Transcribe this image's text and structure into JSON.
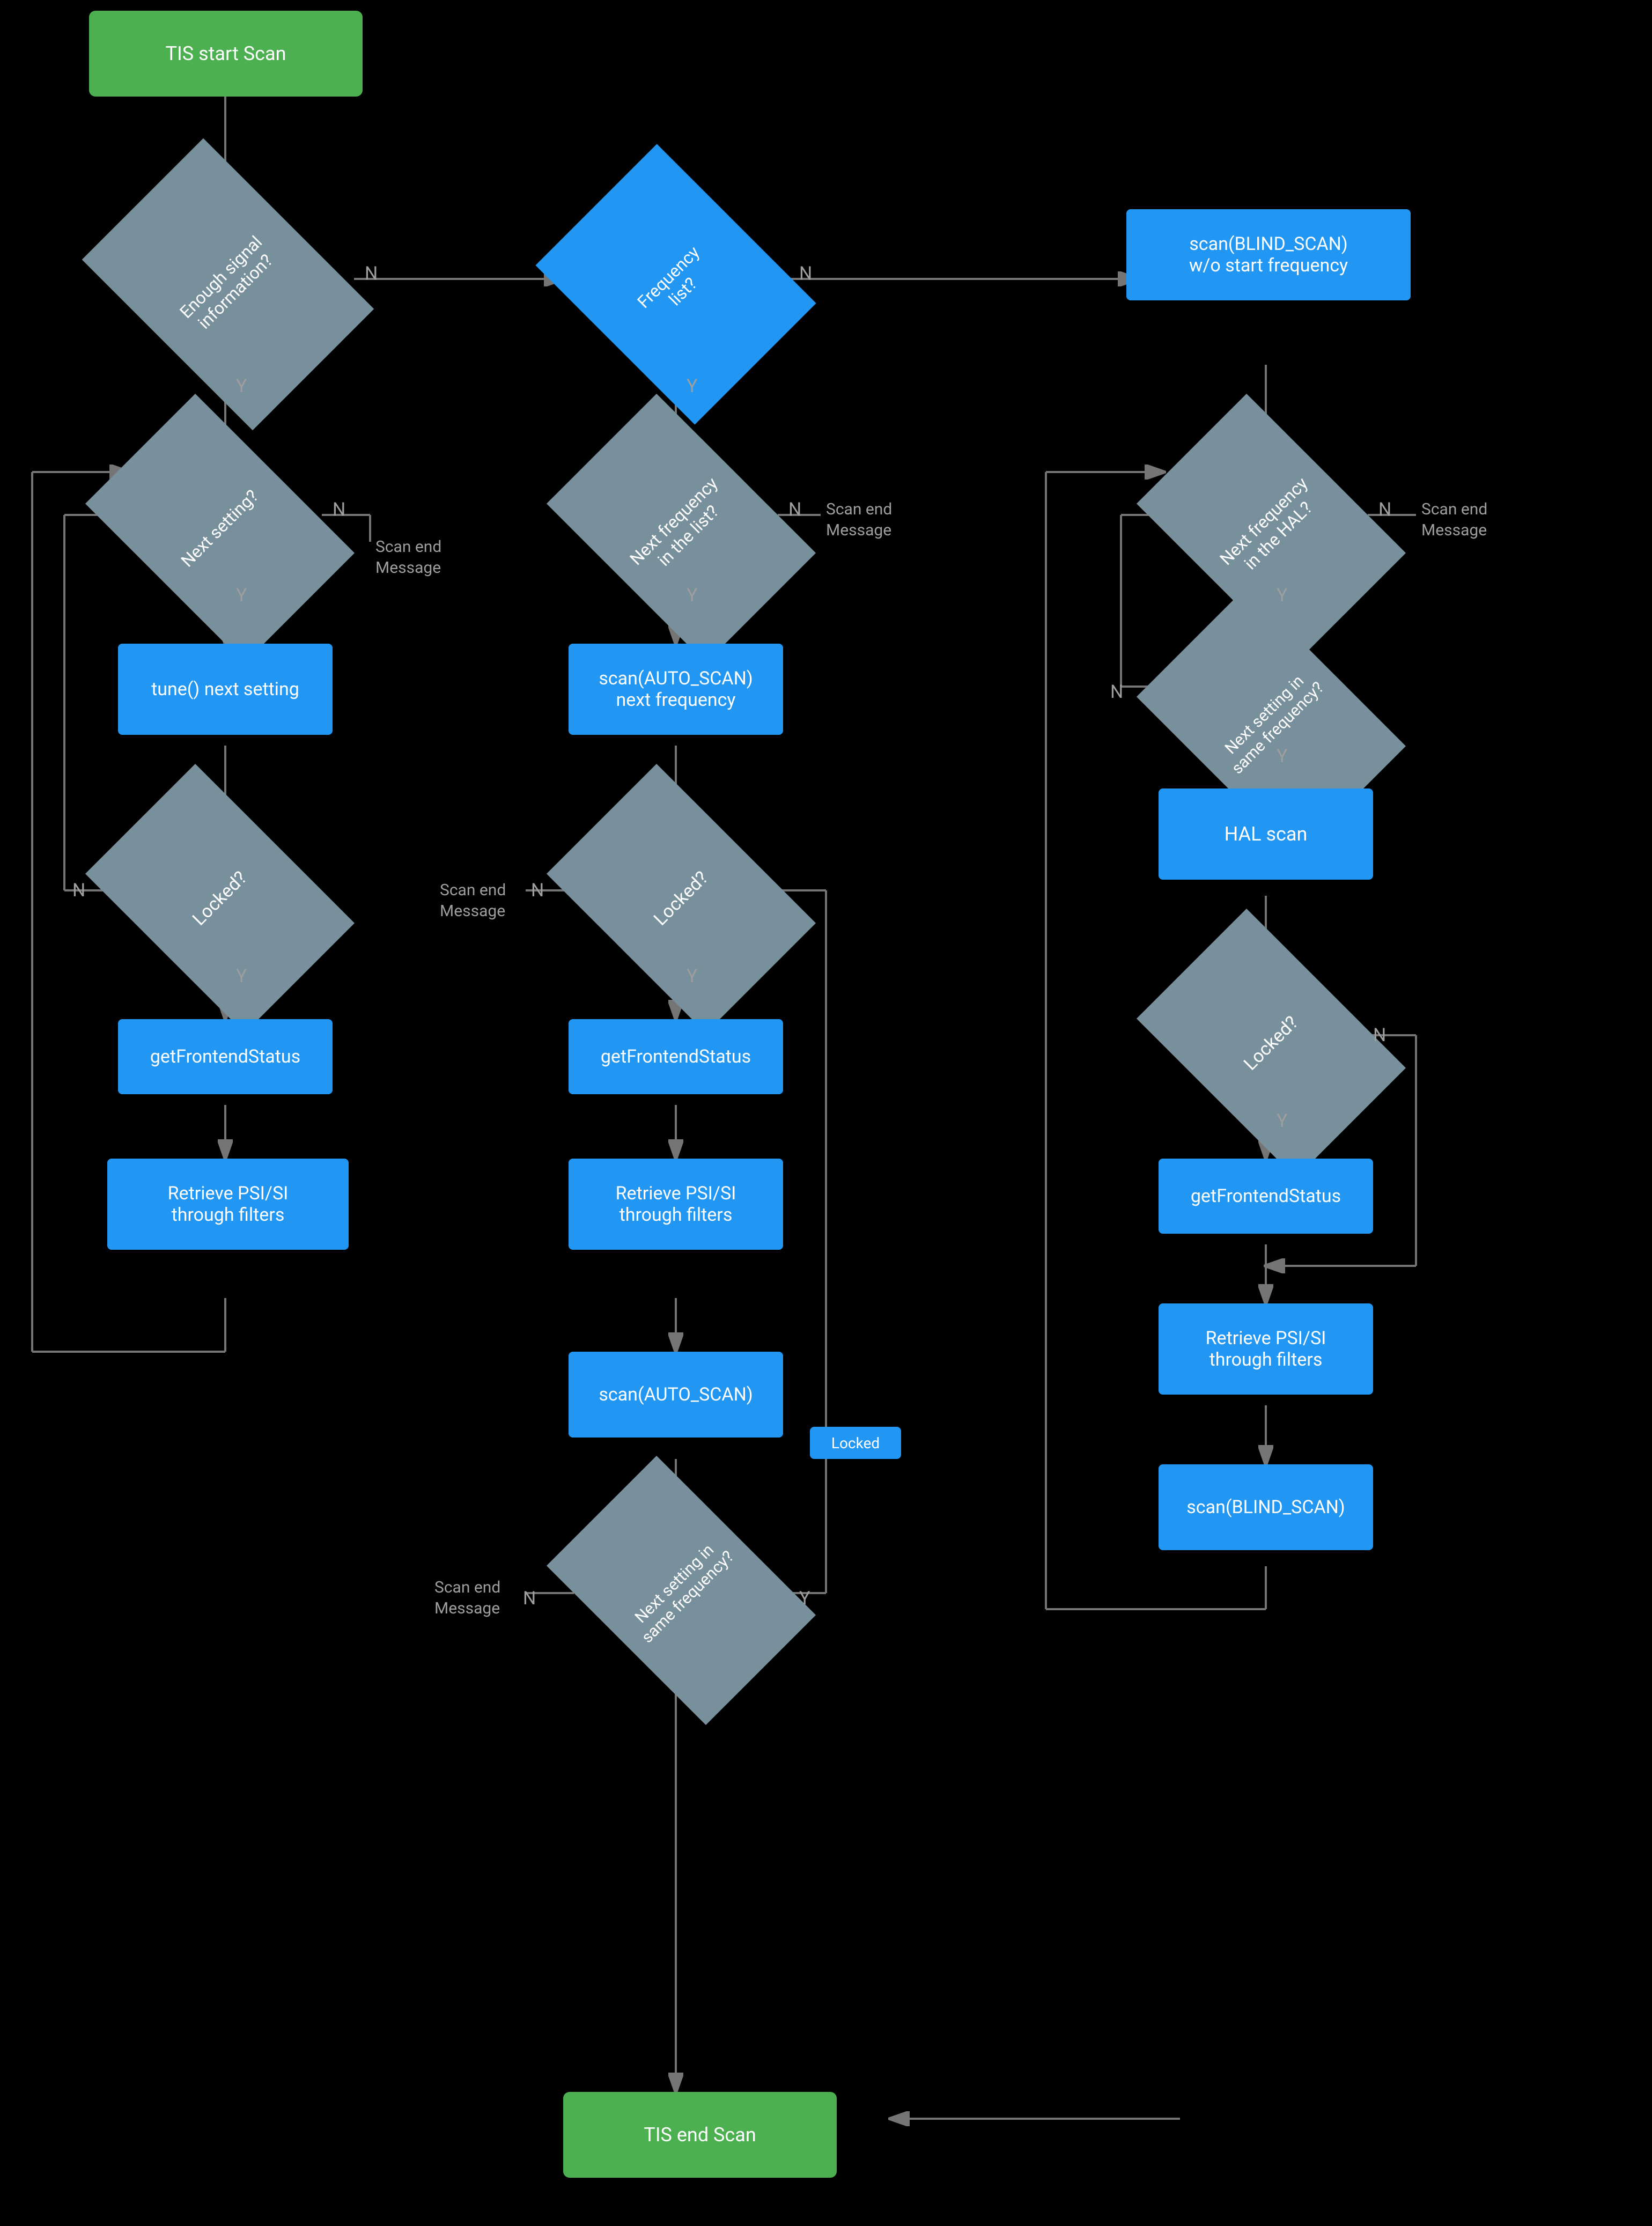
{
  "nodes": {
    "start": {
      "label": "TIS start Scan"
    },
    "enough_signal": {
      "label": "Enough signal\ninformation?"
    },
    "frequency_list": {
      "label": "Frequency\nlist?"
    },
    "blind_scan_no_start": {
      "label": "scan(BLIND_SCAN)\nw/o start frequency"
    },
    "next_setting": {
      "label": "Next setting?"
    },
    "next_freq_list": {
      "label": "Next frequency\nin the list?"
    },
    "next_freq_hal": {
      "label": "Next frequency\nin the HAL?"
    },
    "tune_next": {
      "label": "tune() next setting"
    },
    "scan_auto_next": {
      "label": "scan(AUTO_SCAN)\nnext frequency"
    },
    "next_setting_same_freq_right": {
      "label": "Next setting in\nsame frequency?"
    },
    "locked1": {
      "label": "Locked?"
    },
    "locked2": {
      "label": "Locked?"
    },
    "hal_scan": {
      "label": "HAL scan"
    },
    "get_frontend1": {
      "label": "getFrontendStatus"
    },
    "get_frontend2": {
      "label": "getFrontendStatus"
    },
    "locked3": {
      "label": "Locked?"
    },
    "get_frontend3": {
      "label": "getFrontendStatus"
    },
    "retrieve_psi1": {
      "label": "Retrieve PSI/SI\nthrough filters"
    },
    "retrieve_psi2": {
      "label": "Retrieve PSI/SI\nthrough filters"
    },
    "retrieve_psi3": {
      "label": "Retrieve PSI/SI\nthrough filters"
    },
    "scan_auto2": {
      "label": "scan(AUTO_SCAN)"
    },
    "scan_blind2": {
      "label": "scan(BLIND_SCAN)"
    },
    "next_setting_same_freq_mid": {
      "label": "Next setting in\nsame frequency?"
    },
    "end": {
      "label": "TIS end Scan"
    },
    "locked_badge": {
      "label": "Locked"
    },
    "scan_end_1": {
      "label": "Scan end\nMessage"
    },
    "scan_end_2": {
      "label": "Scan end\nMessage"
    },
    "scan_end_3": {
      "label": "Scan end\nMessage"
    },
    "scan_end_4": {
      "label": "Scan end\nMessage"
    }
  },
  "arrows": {
    "n_label": "N",
    "y_label": "Y"
  }
}
